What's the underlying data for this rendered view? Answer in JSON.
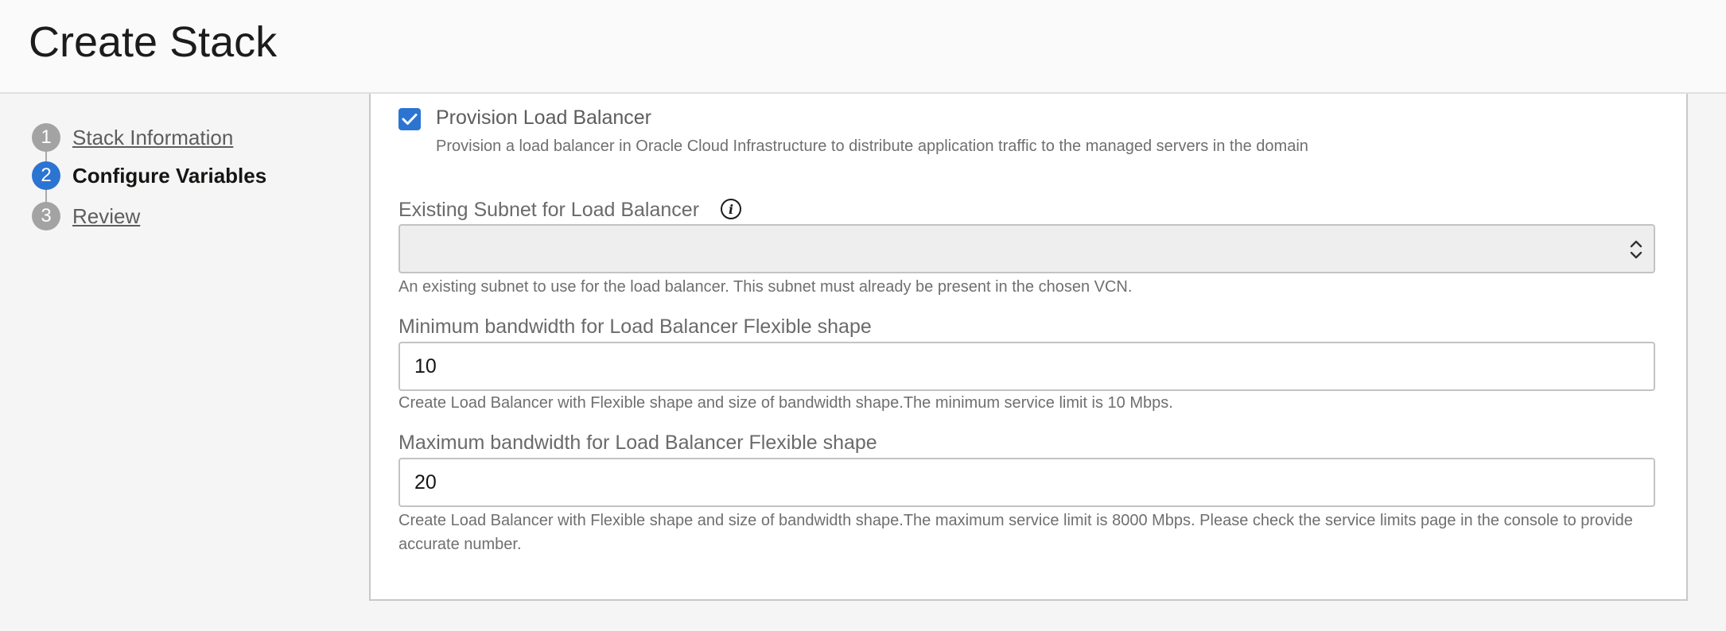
{
  "header": {
    "title": "Create Stack"
  },
  "steps": [
    {
      "number": "1",
      "label": "Stack Information",
      "active": false
    },
    {
      "number": "2",
      "label": "Configure Variables",
      "active": true
    },
    {
      "number": "3",
      "label": "Review",
      "active": false
    }
  ],
  "form": {
    "provision_lb": {
      "checked": true,
      "label": "Provision Load Balancer",
      "description": "Provision a load balancer in Oracle Cloud Infrastructure to distribute application traffic to the managed servers in the domain"
    },
    "subnet": {
      "label": "Existing Subnet for Load Balancer",
      "value": "",
      "help": "An existing subnet to use for the load balancer. This subnet must already be present in the chosen VCN."
    },
    "min_bandwidth": {
      "label": "Minimum bandwidth for Load Balancer Flexible shape",
      "value": "10",
      "help": "Create Load Balancer with Flexible shape and size of bandwidth shape.The minimum service limit is 10 Mbps."
    },
    "max_bandwidth": {
      "label": "Maximum bandwidth for Load Balancer Flexible shape",
      "value": "20",
      "help": "Create Load Balancer with Flexible shape and size of bandwidth shape.The maximum service limit is 8000 Mbps. Please check the service limits page in the console to provide accurate number."
    }
  },
  "colors": {
    "accent": "#2c74d2",
    "step_inactive": "#a3a3a3"
  },
  "icons": {
    "checkbox": "checkmark-icon",
    "info": "info-icon",
    "select": "chevron-up-down-icon"
  }
}
